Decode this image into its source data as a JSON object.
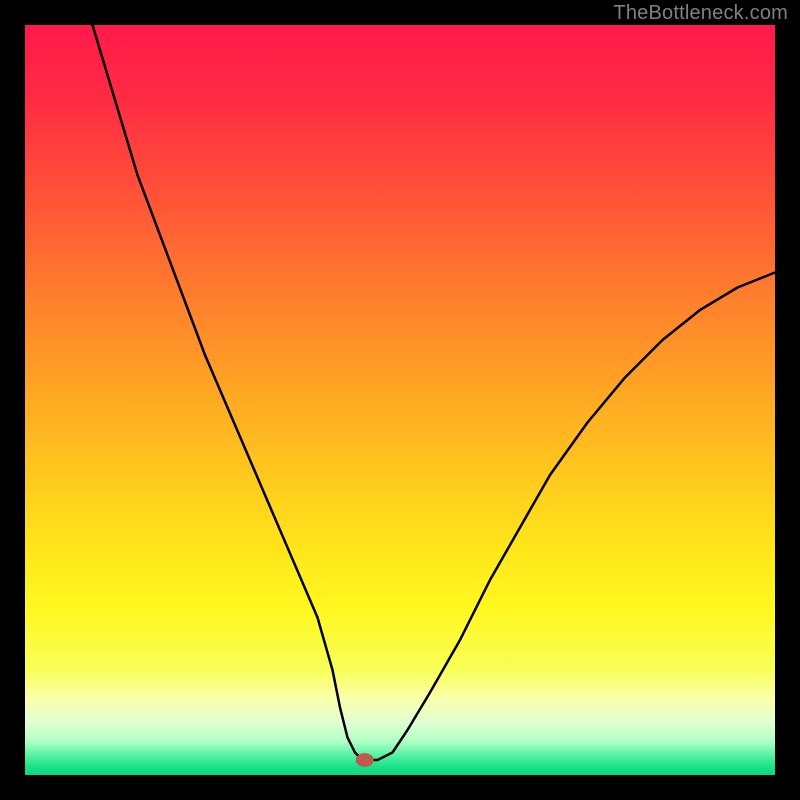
{
  "watermark": "TheBottleneck.com",
  "colors": {
    "frame": "#000000",
    "watermark": "#808080",
    "curve": "#000000",
    "gradient_stops": [
      {
        "offset": 0.0,
        "color": "#ff1a4a"
      },
      {
        "offset": 0.1,
        "color": "#ff2b44"
      },
      {
        "offset": 0.2,
        "color": "#ff4a3a"
      },
      {
        "offset": 0.3,
        "color": "#ff6a32"
      },
      {
        "offset": 0.4,
        "color": "#ff8a2a"
      },
      {
        "offset": 0.5,
        "color": "#ffaa22"
      },
      {
        "offset": 0.6,
        "color": "#ffc81e"
      },
      {
        "offset": 0.7,
        "color": "#ffe61a"
      },
      {
        "offset": 0.78,
        "color": "#fff820"
      },
      {
        "offset": 0.86,
        "color": "#f8ff58"
      },
      {
        "offset": 0.9,
        "color": "#faffb0"
      },
      {
        "offset": 0.93,
        "color": "#e0ffd0"
      },
      {
        "offset": 0.955,
        "color": "#b0ffc8"
      },
      {
        "offset": 0.975,
        "color": "#50f0a0"
      },
      {
        "offset": 0.99,
        "color": "#18e088"
      },
      {
        "offset": 1.0,
        "color": "#10d880"
      }
    ],
    "marker": {
      "fill": "#c05a4a",
      "stroke": "#7a3528"
    }
  },
  "chart_data": {
    "type": "line",
    "title": "",
    "xlabel": "",
    "ylabel": "",
    "xlim": [
      0,
      100
    ],
    "ylim": [
      0,
      100
    ],
    "grid": false,
    "legend": false,
    "series": [
      {
        "name": "bottleneck-curve",
        "x": [
          9,
          12,
          15,
          18,
          21,
          24,
          27,
          30,
          33,
          36,
          39,
          41,
          42,
          43,
          44,
          45,
          47,
          49,
          51,
          54,
          58,
          62,
          66,
          70,
          75,
          80,
          85,
          90,
          95,
          100
        ],
        "y": [
          100,
          90,
          80,
          72,
          64,
          56,
          49,
          42,
          35,
          28,
          21,
          14,
          9,
          5,
          3,
          2,
          2,
          3,
          6,
          11,
          18,
          26,
          33,
          40,
          47,
          53,
          58,
          62,
          65,
          67
        ]
      }
    ],
    "marker": {
      "x": 45.3,
      "y": 2.0,
      "rx": 1.2,
      "ry": 0.9
    }
  }
}
